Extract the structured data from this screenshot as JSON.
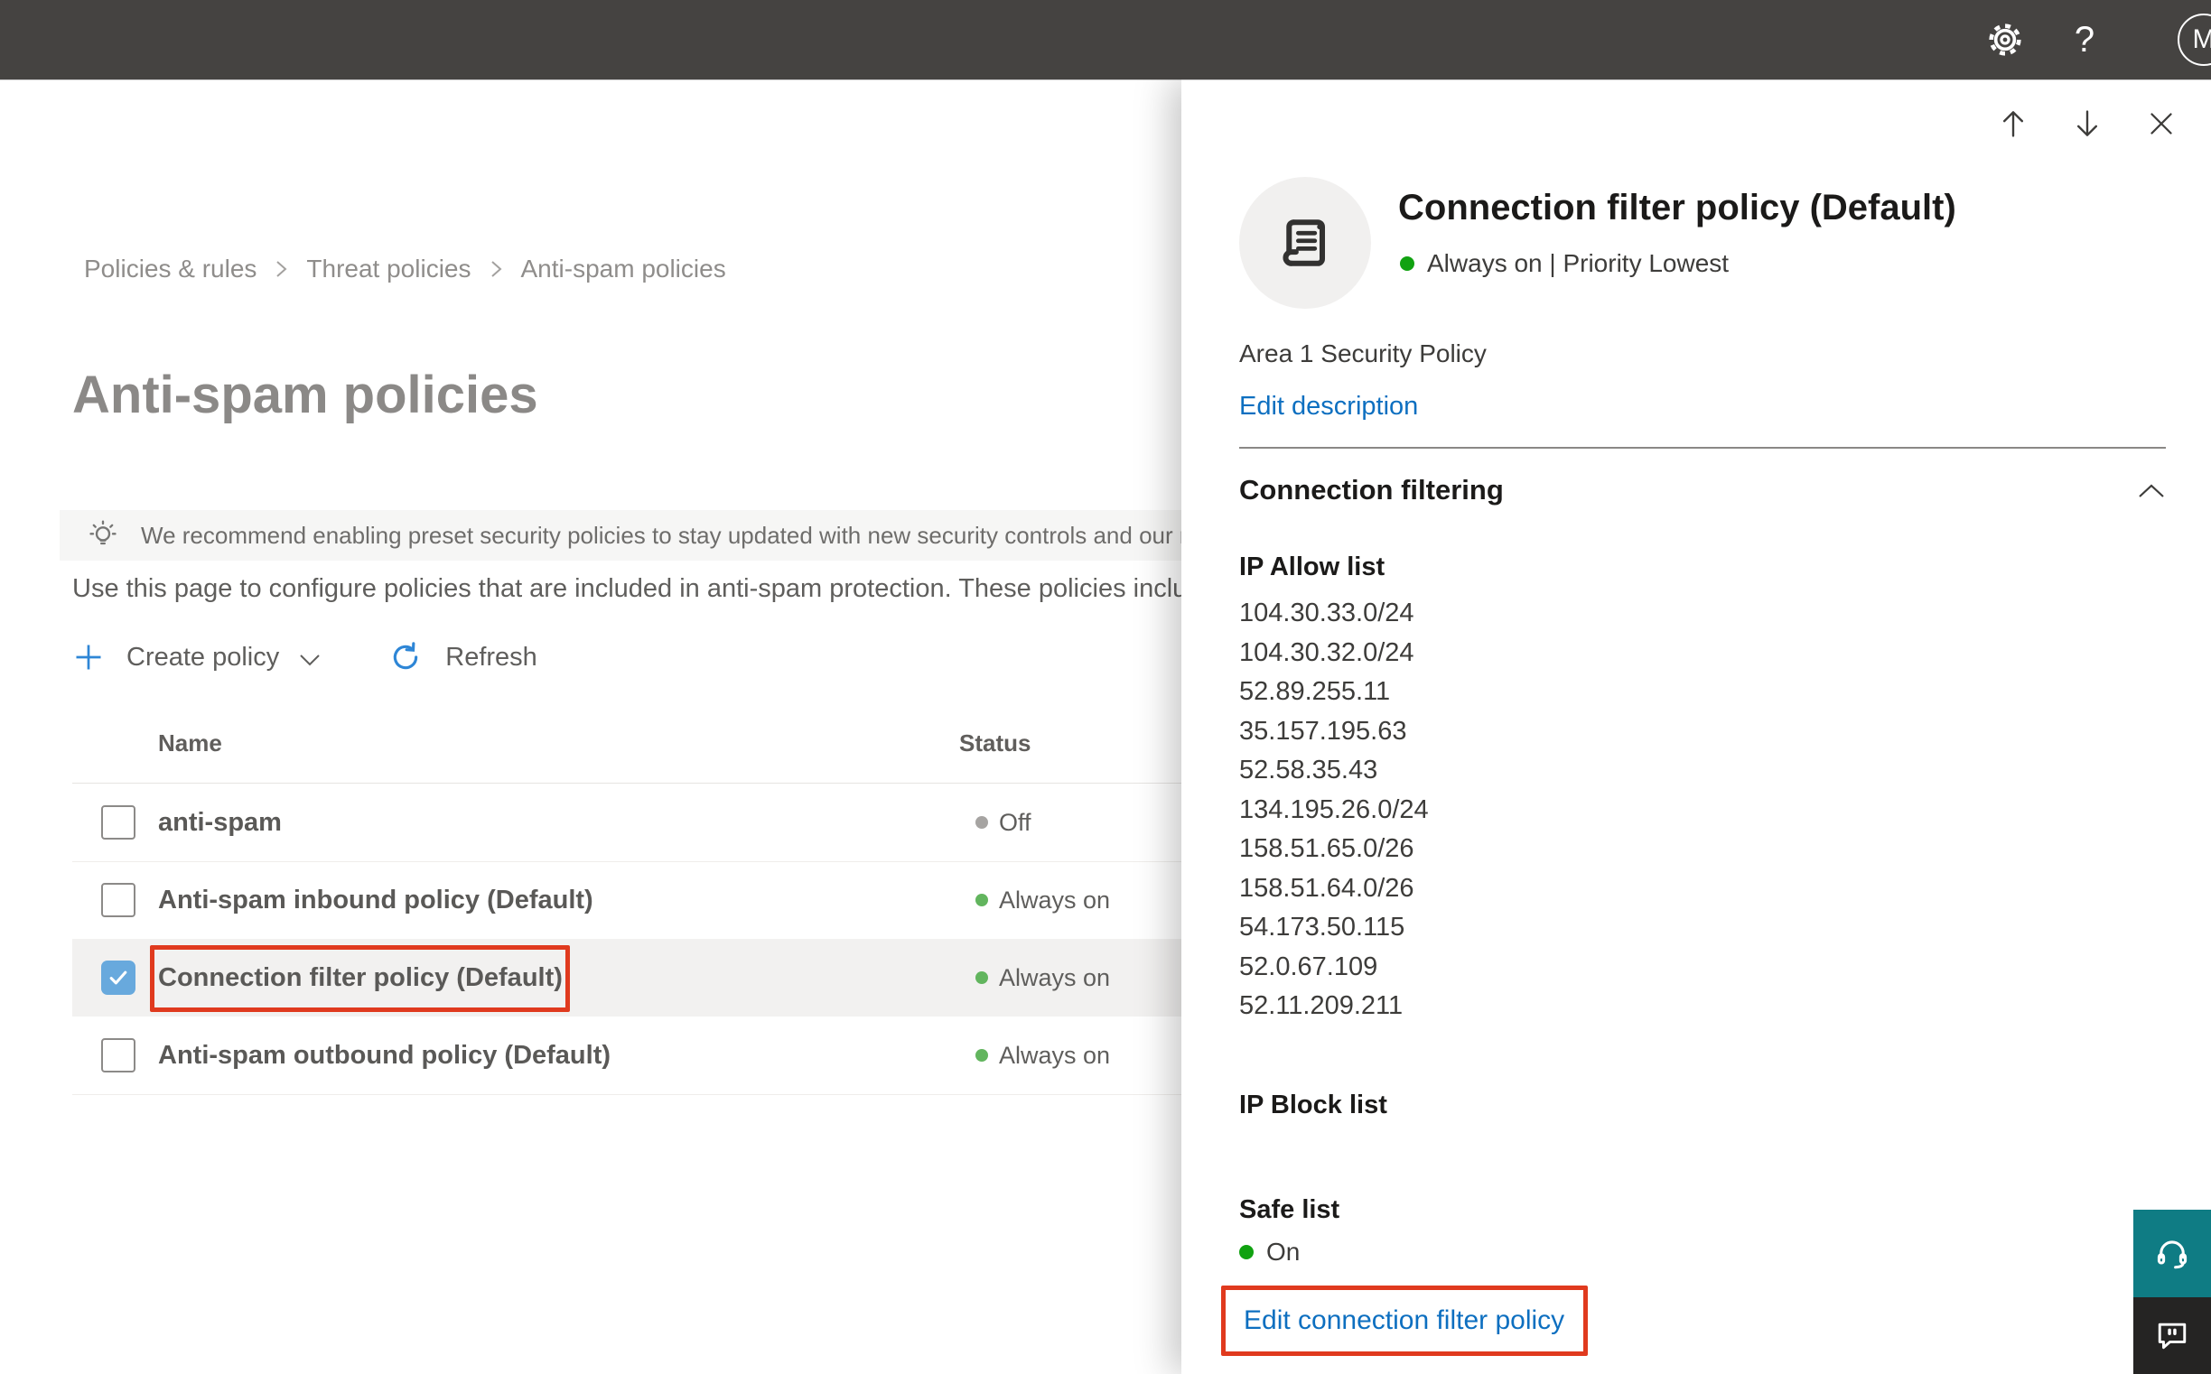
{
  "colors": {
    "topbar_bg": "#454341",
    "accent_blue": "#2e86d6",
    "link_blue": "#0d6fc0",
    "checkbox_blue": "#68a9dd",
    "status_green": "#62b55e",
    "panel_green": "#11a211",
    "status_gray": "#a6a4a2",
    "highlight_red": "#e03a1e",
    "row_highlight": "#f2f1f0",
    "teal_button": "#0f7c84",
    "feedback_button": "#252423"
  },
  "topbar": {
    "avatar_initial": "M"
  },
  "breadcrumb": {
    "items": [
      "Policies & rules",
      "Threat policies",
      "Anti-spam policies"
    ]
  },
  "page": {
    "title": "Anti-spam policies",
    "banner_text": "We recommend enabling preset security policies to stay updated with new security controls and our recomme",
    "description": "Use this page to configure policies that are included in anti-spam protection. These policies include"
  },
  "toolbar": {
    "create_policy_label": "Create policy",
    "refresh_label": "Refresh"
  },
  "table": {
    "columns": {
      "name": "Name",
      "status": "Status"
    },
    "rows": [
      {
        "name": "anti-spam",
        "status": "Off",
        "status_kind": "off",
        "checked": false,
        "selected": false
      },
      {
        "name": "Anti-spam inbound policy (Default)",
        "status": "Always on",
        "status_kind": "on",
        "checked": false,
        "selected": false
      },
      {
        "name": "Connection filter policy (Default)",
        "status": "Always on",
        "status_kind": "on",
        "checked": true,
        "selected": true
      },
      {
        "name": "Anti-spam outbound policy (Default)",
        "status": "Always on",
        "status_kind": "on",
        "checked": false,
        "selected": false
      }
    ]
  },
  "panel": {
    "title": "Connection filter policy (Default)",
    "status_line": "Always on | Priority Lowest",
    "description": "Area 1 Security Policy",
    "edit_description_label": "Edit description",
    "section_title": "Connection filtering",
    "ip_allow": {
      "heading": "IP Allow list",
      "items": [
        "104.30.33.0/24",
        "104.30.32.0/24",
        "52.89.255.11",
        "35.157.195.63",
        "52.58.35.43",
        "134.195.26.0/24",
        "158.51.65.0/26",
        "158.51.64.0/26",
        "54.173.50.115",
        "52.0.67.109",
        "52.11.209.211"
      ]
    },
    "ip_block": {
      "heading": "IP Block list"
    },
    "safe_list": {
      "heading": "Safe list",
      "status": "On"
    },
    "edit_policy_label": "Edit connection filter policy"
  }
}
